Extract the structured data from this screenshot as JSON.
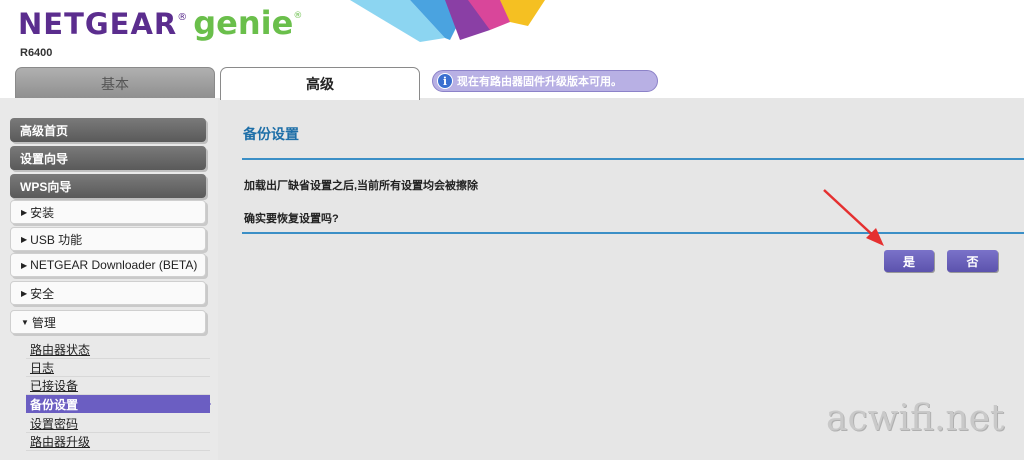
{
  "header": {
    "brand_primary": "NETGEAR",
    "brand_reg": "®",
    "brand_secondary": "genie",
    "brand_secondary_reg": "®",
    "model": "R6400"
  },
  "tabs": [
    {
      "label": "基本",
      "active": false
    },
    {
      "label": "高级",
      "active": true
    }
  ],
  "notice": {
    "icon": "info-icon",
    "icon_glyph": "i",
    "text": "现在有路由器固件升级版本可用。"
  },
  "sidebar": {
    "primary_items": [
      {
        "label": "高级首页"
      },
      {
        "label": "设置向导"
      },
      {
        "label": "WPS向导"
      }
    ],
    "sections": [
      {
        "label": "安装",
        "expanded": false,
        "marker": "▶"
      },
      {
        "label": "USB 功能",
        "expanded": false,
        "marker": "▶"
      },
      {
        "label": "NETGEAR Downloader (BETA)",
        "expanded": false,
        "marker": "▶"
      },
      {
        "label": "安全",
        "expanded": false,
        "marker": "▶"
      },
      {
        "label": "管理",
        "expanded": true,
        "marker": "▼"
      }
    ],
    "admin_items": [
      {
        "label": "路由器状态",
        "active": false
      },
      {
        "label": "日志",
        "active": false
      },
      {
        "label": "已接设备",
        "active": false
      },
      {
        "label": "备份设置",
        "active": true
      },
      {
        "label": "设置密码",
        "active": false
      },
      {
        "label": "路由器升级",
        "active": false
      }
    ]
  },
  "main": {
    "title": "备份设置",
    "message_line1": "加载出厂缺省设置之后,当前所有设置均会被擦除",
    "message_line2": "确实要恢复设置吗?",
    "yes_label": "是",
    "no_label": "否"
  },
  "watermark": "acwifi.net",
  "colors": {
    "brand_purple": "#5b2d8e",
    "brand_green": "#6abf4b",
    "accent_blue": "#3b8fc6",
    "button_purple": "#6b5ec2",
    "annotation_red": "#e53030"
  }
}
